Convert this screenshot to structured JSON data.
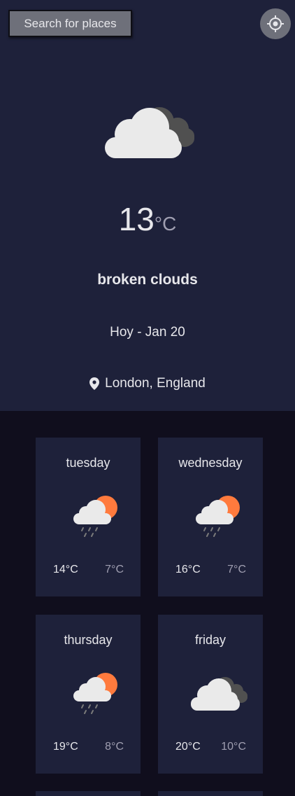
{
  "search": {
    "label": "Search for places"
  },
  "current": {
    "icon": "broken-clouds-icon",
    "temp": "13",
    "unit": "°C",
    "description": "broken clouds",
    "date": "Hoy - Jan 20",
    "location": "London, England"
  },
  "forecast": [
    {
      "day": "tuesday",
      "icon": "light-rain-sun-icon",
      "max": "14°C",
      "min": "7°C"
    },
    {
      "day": "wednesday",
      "icon": "light-rain-sun-icon",
      "max": "16°C",
      "min": "7°C"
    },
    {
      "day": "thursday",
      "icon": "light-rain-sun-icon",
      "max": "19°C",
      "min": "8°C"
    },
    {
      "day": "friday",
      "icon": "broken-clouds-icon",
      "max": "20°C",
      "min": "10°C"
    }
  ],
  "colors": {
    "panel": "#1e213a",
    "background": "#100e1d",
    "sun": "#ff7a3d",
    "text": "#e7e7eb",
    "muted": "#a09fb1"
  }
}
